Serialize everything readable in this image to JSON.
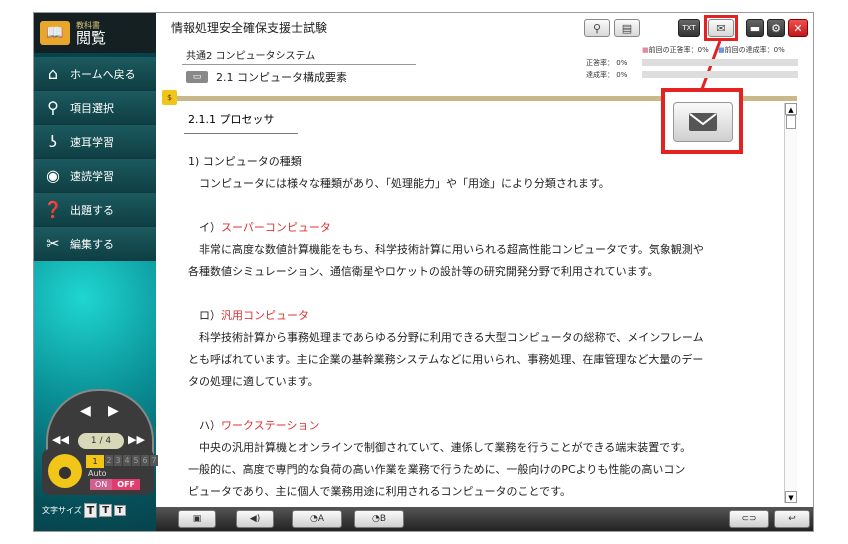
{
  "brand": {
    "small": "教科書",
    "big": "閲覧"
  },
  "nav": [
    {
      "label": "ホームへ戻る",
      "icon": "home-icon"
    },
    {
      "label": "項目選択",
      "icon": "search-select-icon"
    },
    {
      "label": "速耳学習",
      "icon": "ear-icon"
    },
    {
      "label": "速読学習",
      "icon": "eye-icon"
    },
    {
      "label": "出題する",
      "icon": "quiz-icon"
    },
    {
      "label": "編集する",
      "icon": "scissors-icon"
    }
  ],
  "controller": {
    "page": "1 / 4",
    "auto": "Auto",
    "on": "ON",
    "off": "OFF",
    "speeds": [
      "1",
      "2",
      "3",
      "4",
      "5",
      "6",
      "7"
    ]
  },
  "font_size": {
    "label": "文字サイズ"
  },
  "header": {
    "title": "情報処理安全確保支援士試験",
    "course": "共通2 コンピュータシステム",
    "section": "2.1  コンピュータ構成要素",
    "txt_label": "TXT"
  },
  "stats": {
    "prev_correct_label": "前回の正答率：",
    "prev_correct": "0%",
    "prev_achieve_label": "前回の達成率：",
    "prev_achieve": "0%",
    "correct_label": "正答率：",
    "correct": "0%",
    "achieve_label": "達成率：",
    "achieve": "0%"
  },
  "content": {
    "heading": "2.1.1  プロセッサ",
    "l1": "1) コンピュータの種類",
    "l2": "　コンピュータには様々な種類があり、「処理能力」や「用途」により分類されます。",
    "a_prefix": "　イ）",
    "a_title": "スーパーコンピュータ",
    "a1": "　非常に高度な数値計算機能をもち、科学技術計算に用いられる超高性能コンピュータです。気象観測や",
    "a2": "各種数値シミュレーション、通信衛星やロケットの設計等の研究開発分野で利用されています。",
    "b_prefix": "　ロ）",
    "b_title": "汎用コンピュータ",
    "b1": "　科学技術計算から事務処理まであらゆる分野に利用できる大型コンピュータの総称で、メインフレーム",
    "b2": "とも呼ばれています。主に企業の基幹業務システムなどに用いられ、事務処理、在庫管理など大量のデー",
    "b3": "タの処理に適しています。",
    "c_prefix": "　ハ）",
    "c_title": "ワークステーション",
    "c1": "　中央の汎用計算機とオンラインで制御されていて、連係して業務を行うことができる端末装置です。",
    "c2": "一般的に、高度で専門的な負荷の高い作業を業務で行うために、一般向けのPCよりも性能の高いコン",
    "c3": "ピュータであり、主に個人で業務用途に利用されるコンピュータのことです。"
  },
  "bottom": {
    "a_label": "A",
    "b_label": "B"
  },
  "colors": {
    "accent_red": "#e32222",
    "term_red": "#e03131",
    "sidebar": "#0a8f96"
  }
}
